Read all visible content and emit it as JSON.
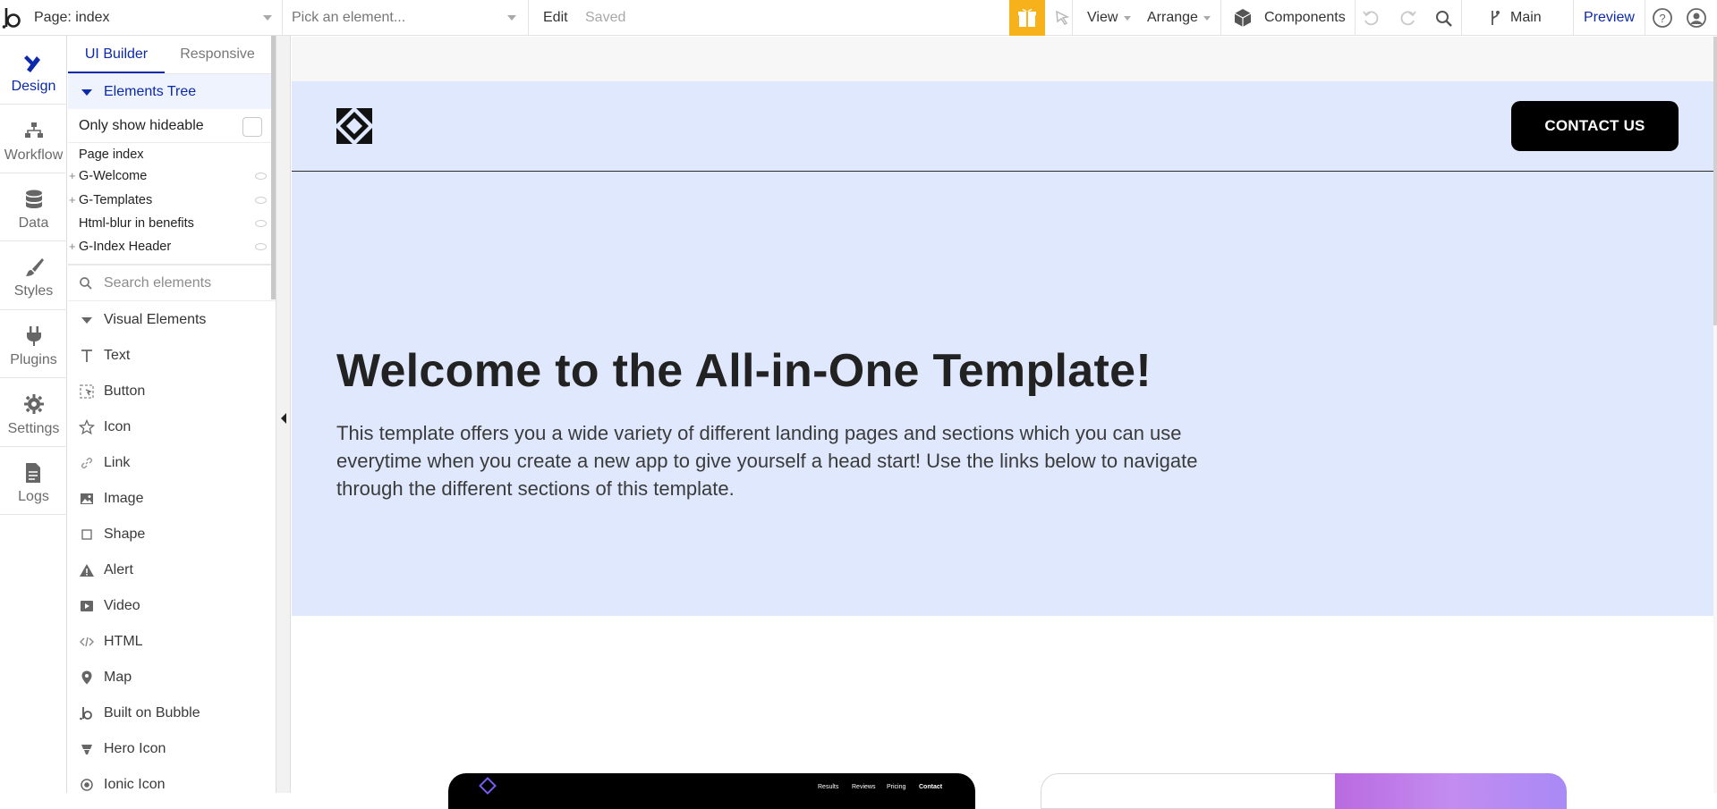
{
  "topbar": {
    "page_selector": "Page: index",
    "element_picker_placeholder": "Pick an element...",
    "edit": "Edit",
    "saved": "Saved",
    "view": "View",
    "arrange": "Arrange",
    "components": "Components",
    "branch": "Main",
    "preview": "Preview",
    "accent": "#f7b21b"
  },
  "rail": {
    "items": [
      {
        "label": "Design",
        "icon": "design-icon"
      },
      {
        "label": "Workflow",
        "icon": "workflow-icon"
      },
      {
        "label": "Data",
        "icon": "database-icon"
      },
      {
        "label": "Styles",
        "icon": "brush-icon"
      },
      {
        "label": "Plugins",
        "icon": "plug-icon"
      },
      {
        "label": "Settings",
        "icon": "gear-icon"
      },
      {
        "label": "Logs",
        "icon": "document-icon"
      }
    ]
  },
  "panel": {
    "tabs": [
      "UI Builder",
      "Responsive"
    ],
    "elements_tree": "Elements Tree",
    "only_show_hideable": "Only show hideable",
    "tree": [
      "Page index",
      "G-Welcome",
      "G-Templates",
      "Html-blur in benefits",
      "G-Index Header"
    ],
    "search_placeholder": "Search elements",
    "visual_elements": "Visual Elements",
    "elements": [
      "Text",
      "Button",
      "Icon",
      "Link",
      "Image",
      "Shape",
      "Alert",
      "Video",
      "HTML",
      "Map",
      "Built on Bubble",
      "Hero Icon",
      "Ionic Icon"
    ]
  },
  "canvas": {
    "contact_button": "CONTACT US",
    "hero_title": "Welcome to the All-in-One Template!",
    "hero_body": "This template offers you a wide variety of different landing pages and sections which you can use everytime when you create a new app to give yourself a head start! Use the links below to navigate through the different sections of this template.",
    "thumb_nav": [
      "Results",
      "Reviews",
      "Pricing",
      "Contact"
    ],
    "hero_background": "#dfe8fc"
  }
}
